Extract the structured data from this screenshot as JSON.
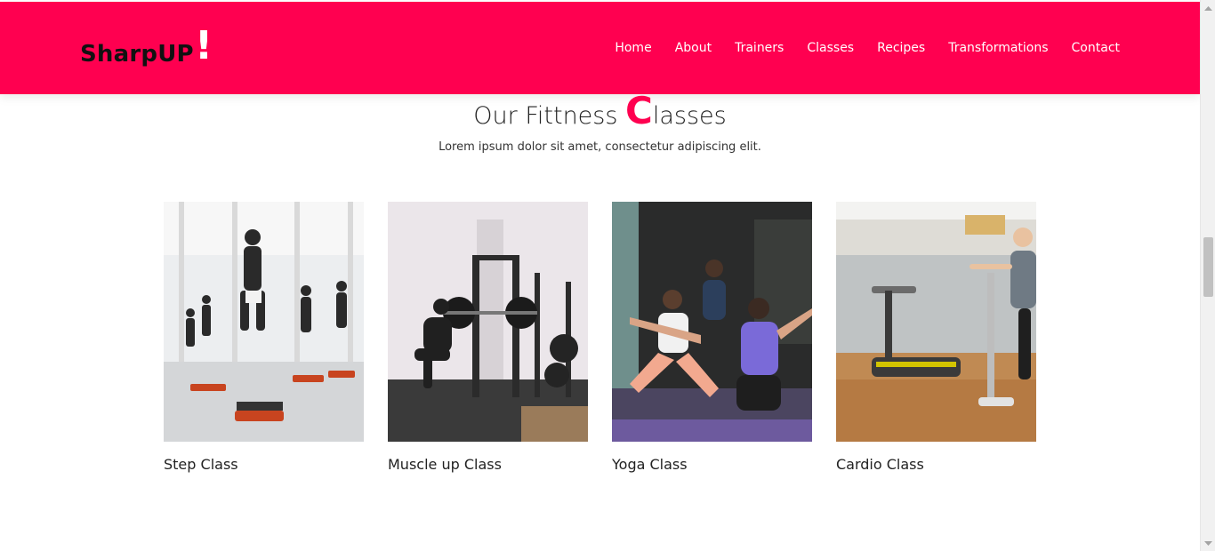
{
  "header": {
    "brand": "SharpUP",
    "brand_mark": "!",
    "nav": [
      "Home",
      "About",
      "Trainers",
      "Classes",
      "Recipes",
      "Transformations",
      "Contact"
    ]
  },
  "section": {
    "title_pre": "Our Fittness ",
    "title_cap": "C",
    "title_post": "lasses",
    "subtitle": "Lorem ipsum dolor sit amet, consectetur adipiscing elit."
  },
  "classes": [
    {
      "label": "Step Class",
      "image": "step-class-photo"
    },
    {
      "label": "Muscle up Class",
      "image": "muscle-up-class-photo"
    },
    {
      "label": "Yoga Class",
      "image": "yoga-class-photo"
    },
    {
      "label": "Cardio Class",
      "image": "cardio-class-photo"
    }
  ],
  "colors": {
    "accent": "#ff0050",
    "header_text": "#ffffff",
    "brand_text": "#111111"
  }
}
